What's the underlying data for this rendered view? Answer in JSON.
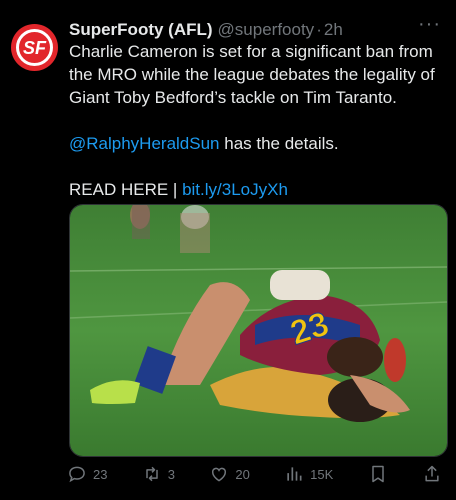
{
  "tweet": {
    "author_name": "SuperFooty (AFL)",
    "handle": "@superfooty",
    "separator": "·",
    "time": "2h",
    "avatar_logo": "SF",
    "text_line": "Charlie Cameron is set for a significant ban from the MRO while the league debates the legality of Giant Toby Bedford’s tackle on Tim Taranto.",
    "mention": "@RalphyHeraldSun",
    "mention_suffix": " has the details.",
    "read_here": "READ HERE | ",
    "link": "bit.ly/3LoJyXh",
    "media_alt": "Two AFL players in a tackle on the grass, player in jersey number 23",
    "jersey_number": "23"
  },
  "actions": {
    "replies": "23",
    "retweets": "3",
    "likes": "20",
    "views": "15K"
  },
  "colors": {
    "background": "#000000",
    "link": "#1d9bf0",
    "muted": "#71767b",
    "avatar": "#e2262b"
  },
  "icons": [
    "more-icon",
    "reply-icon",
    "retweet-icon",
    "like-icon",
    "views-icon",
    "bookmark-icon",
    "share-icon"
  ]
}
